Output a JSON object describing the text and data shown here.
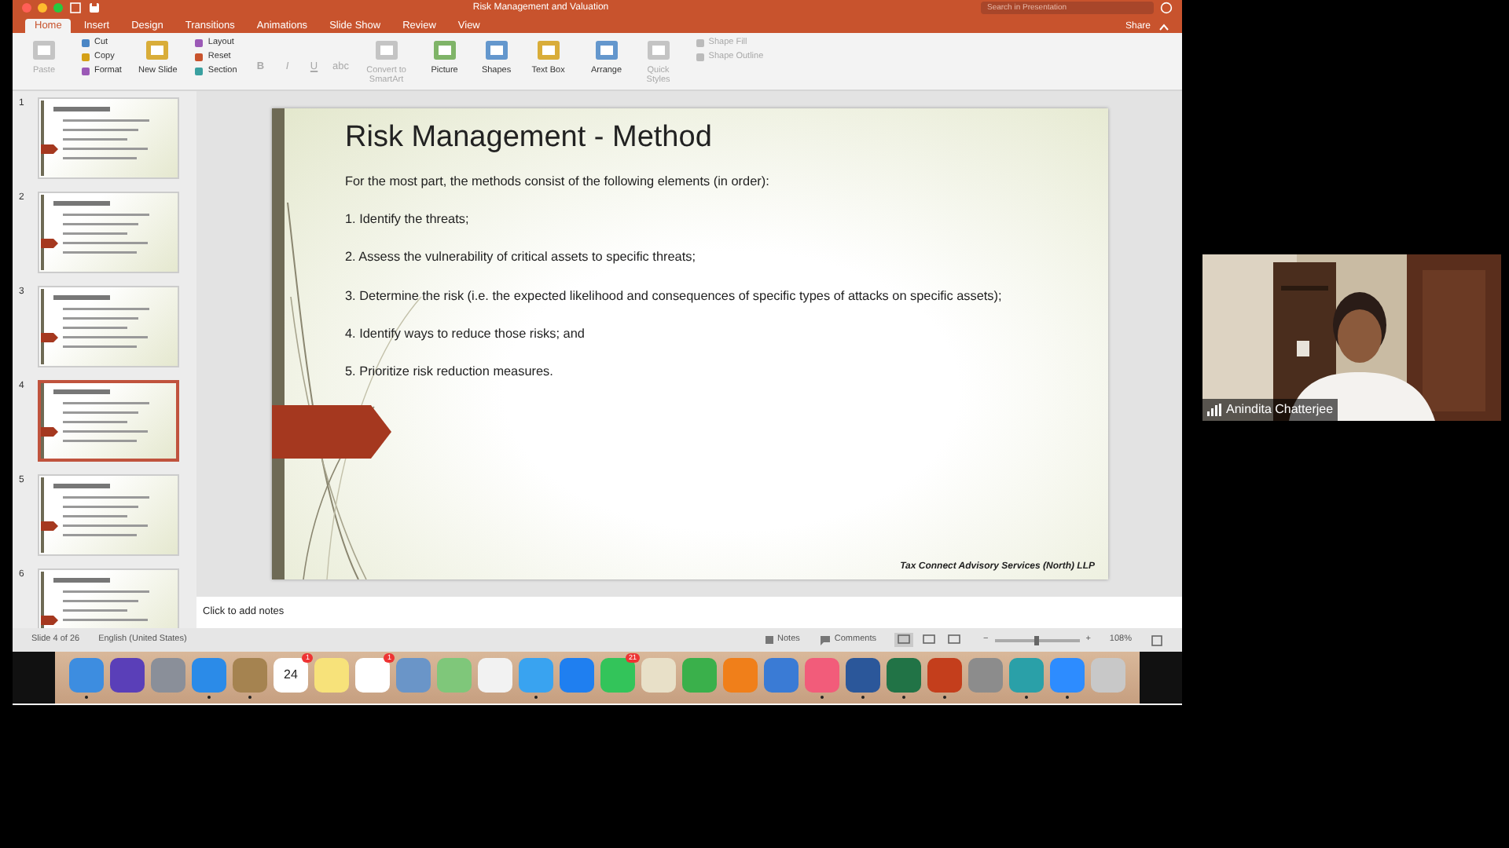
{
  "window": {
    "title": "Risk Management and Valuation",
    "search": {
      "placeholder": "Search in Presentation"
    },
    "share": "Share"
  },
  "tabs": [
    {
      "label": "Home",
      "selected": true
    },
    {
      "label": "Insert",
      "selected": false
    },
    {
      "label": "Design",
      "selected": false
    },
    {
      "label": "Transitions",
      "selected": false
    },
    {
      "label": "Animations",
      "selected": false
    },
    {
      "label": "Slide Show",
      "selected": false
    },
    {
      "label": "Review",
      "selected": false
    },
    {
      "label": "View",
      "selected": false
    }
  ],
  "ribbon": {
    "groups": [
      {
        "items": [
          {
            "label": "Paste",
            "kind": "large",
            "disabled": true
          }
        ]
      },
      {
        "items": [
          {
            "label": "Cut",
            "kind": "small",
            "disabled": false
          },
          {
            "label": "Copy",
            "kind": "small",
            "disabled": false
          },
          {
            "label": "Format",
            "kind": "small",
            "disabled": false
          }
        ]
      },
      {
        "items": [
          {
            "label": "New Slide",
            "kind": "large",
            "disabled": false
          }
        ]
      },
      {
        "items": [
          {
            "label": "Layout",
            "kind": "small",
            "disabled": false
          },
          {
            "label": "Reset",
            "kind": "small",
            "disabled": false
          },
          {
            "label": "Section",
            "kind": "small",
            "disabled": false
          }
        ]
      },
      {
        "items": [
          {
            "label": "B",
            "kind": "glyph",
            "disabled": true
          },
          {
            "label": "I",
            "kind": "glyph",
            "disabled": true
          },
          {
            "label": "U",
            "kind": "glyph",
            "disabled": true
          },
          {
            "label": "abc",
            "kind": "glyph",
            "disabled": true
          }
        ]
      },
      {
        "items": [
          {
            "label": "Convert to SmartArt",
            "kind": "large",
            "disabled": true
          }
        ]
      },
      {
        "items": [
          {
            "label": "Picture",
            "kind": "large",
            "disabled": false
          },
          {
            "label": "Shapes",
            "kind": "large",
            "disabled": false
          },
          {
            "label": "Text Box",
            "kind": "large",
            "disabled": false
          }
        ]
      },
      {
        "items": [
          {
            "label": "Arrange",
            "kind": "large",
            "disabled": false
          },
          {
            "label": "Quick Styles",
            "kind": "large",
            "disabled": true
          }
        ]
      },
      {
        "items": [
          {
            "label": "Shape Fill",
            "kind": "small",
            "disabled": true
          },
          {
            "label": "Shape Outline",
            "kind": "small",
            "disabled": true
          }
        ]
      }
    ]
  },
  "thumbnails": [
    {
      "number": "1",
      "selected": false
    },
    {
      "number": "2",
      "selected": false
    },
    {
      "number": "3",
      "selected": false
    },
    {
      "number": "4",
      "selected": true
    },
    {
      "number": "5",
      "selected": false
    },
    {
      "number": "6",
      "selected": false
    }
  ],
  "slide": {
    "title": "Risk Management - Method",
    "intro": "For the most part, the methods consist of the following elements (in order):",
    "items": [
      "1. Identify the threats;",
      "2. Assess the vulnerability of critical assets to specific threats;",
      "3. Determine the risk (i.e. the expected likelihood and consequences of specific types of attacks on specific assets);",
      "4. Identify ways to reduce those risks; and",
      "5. Prioritize risk reduction measures."
    ],
    "footer": "Tax Connect Advisory Services (North) LLP"
  },
  "notes": {
    "placeholder": "Click to add notes"
  },
  "status_bar": {
    "slide": "Slide 4 of 26",
    "language": "English (United States)",
    "notes": "Notes",
    "comments": "Comments",
    "views": [
      {
        "selected": true
      },
      {
        "selected": false
      },
      {
        "selected": false
      }
    ],
    "zoom": {
      "out": "−",
      "in": "+",
      "level": 0.5,
      "reading": "108%"
    }
  },
  "dock": {
    "apps": [
      {
        "running": true
      },
      {
        "running": false
      },
      {
        "running": false
      },
      {
        "running": true
      },
      {
        "running": true
      },
      {
        "running": false,
        "date": "24",
        "badge": "1"
      },
      {
        "running": false
      },
      {
        "running": false,
        "badge": "1"
      },
      {
        "running": false
      },
      {
        "running": false
      },
      {
        "running": false
      },
      {
        "running": true
      },
      {
        "running": false
      },
      {
        "running": false,
        "badge": "21"
      },
      {
        "running": false
      },
      {
        "running": false
      },
      {
        "running": false
      },
      {
        "running": false
      },
      {
        "running": true
      },
      {
        "running": true
      },
      {
        "running": true
      },
      {
        "running": true
      },
      {
        "running": false
      },
      {
        "running": true
      },
      {
        "running": true
      },
      {
        "running": false
      }
    ]
  },
  "video": {
    "name": "Anindita Chatterjee"
  }
}
